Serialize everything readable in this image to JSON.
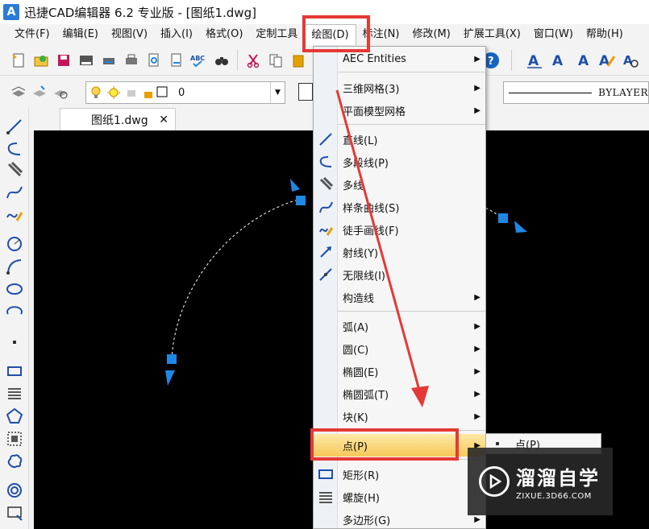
{
  "window": {
    "title": "迅捷CAD编辑器 6.2 专业版  - [图纸1.dwg]",
    "logo": "A"
  },
  "menubar": {
    "items": [
      "文件(F)",
      "编辑(E)",
      "视图(V)",
      "插入(I)",
      "格式(O)",
      "定制工具",
      "绘图(D)",
      "标注(N)",
      "修改(M)",
      "扩展工具(X)",
      "窗口(W)",
      "帮助(H)"
    ]
  },
  "layer": {
    "name": "0"
  },
  "linetype": {
    "label": "BYLAYER"
  },
  "tab": {
    "label": "图纸1.dwg",
    "close": "✕"
  },
  "draw_menu": {
    "items": [
      {
        "label": "AEC Entities",
        "submenu": true
      },
      {
        "label": "三维网格(3)",
        "submenu": true
      },
      {
        "label": "平面模型网格",
        "submenu": true
      },
      {
        "label": "直线(L)",
        "submenu": false
      },
      {
        "label": "多段线(P)",
        "submenu": false
      },
      {
        "label": "多线",
        "submenu": false
      },
      {
        "label": "样条曲线(S)",
        "submenu": false
      },
      {
        "label": "徒手画线(F)",
        "submenu": false
      },
      {
        "label": "射线(Y)",
        "submenu": false
      },
      {
        "label": "无限线(I)",
        "submenu": false
      },
      {
        "label": "构造线",
        "submenu": true
      },
      {
        "label": "弧(A)",
        "submenu": true
      },
      {
        "label": "圆(C)",
        "submenu": true
      },
      {
        "label": "椭圆(E)",
        "submenu": true
      },
      {
        "label": "椭圆弧(T)",
        "submenu": true
      },
      {
        "label": "块(K)",
        "submenu": true
      },
      {
        "label": "点(P)",
        "submenu": true
      },
      {
        "label": "矩形(R)",
        "submenu": false
      },
      {
        "label": "螺旋(H)",
        "submenu": false
      },
      {
        "label": "多边形(G)",
        "submenu": true
      }
    ]
  },
  "point_submenu": {
    "label": "点(P)"
  },
  "watermark": {
    "title": "溜溜自学",
    "url": "ZIXUE.3D66.COM"
  },
  "colors": {
    "accent_red": "#e53935",
    "canvas": "#000000",
    "grip": "#1e88e5"
  }
}
